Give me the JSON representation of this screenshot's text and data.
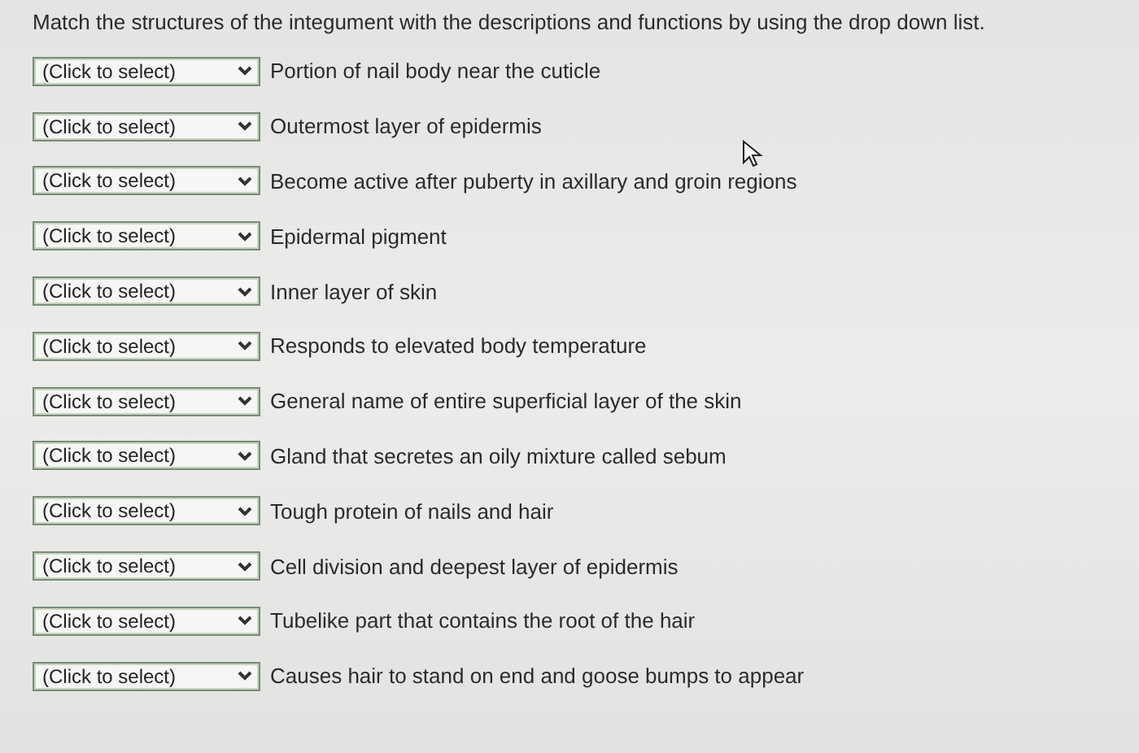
{
  "instruction": "Match the structures of the integument with the descriptions and functions by using the drop down list.",
  "rows": [
    {
      "select": "(Click to select)",
      "description": "Portion of nail body near the cuticle"
    },
    {
      "select": "(Click to select)",
      "description": "Outermost layer of epidermis"
    },
    {
      "select": "(Click to select)",
      "description": "Become active after puberty in axillary and groin regions"
    },
    {
      "select": "(Click to select)",
      "description": "Epidermal pigment"
    },
    {
      "select": "(Click to select)",
      "description": "Inner layer of skin"
    },
    {
      "select": "(Click to select)",
      "description": "Responds to elevated body temperature"
    },
    {
      "select": "(Click to select)",
      "description": "General name of entire superficial layer of the skin"
    },
    {
      "select": "(Click to select)",
      "description": "Gland that secretes an oily mixture called sebum"
    },
    {
      "select": "(Click to select)",
      "description": "Tough protein of nails and hair"
    },
    {
      "select": "(Click to select)",
      "description": "Cell division and deepest layer of epidermis"
    },
    {
      "select": "(Click to select)",
      "description": "Tubelike part that contains the root of the hair"
    },
    {
      "select": "(Click to select)",
      "description": "Causes hair to stand on end and goose bumps to appear"
    }
  ]
}
